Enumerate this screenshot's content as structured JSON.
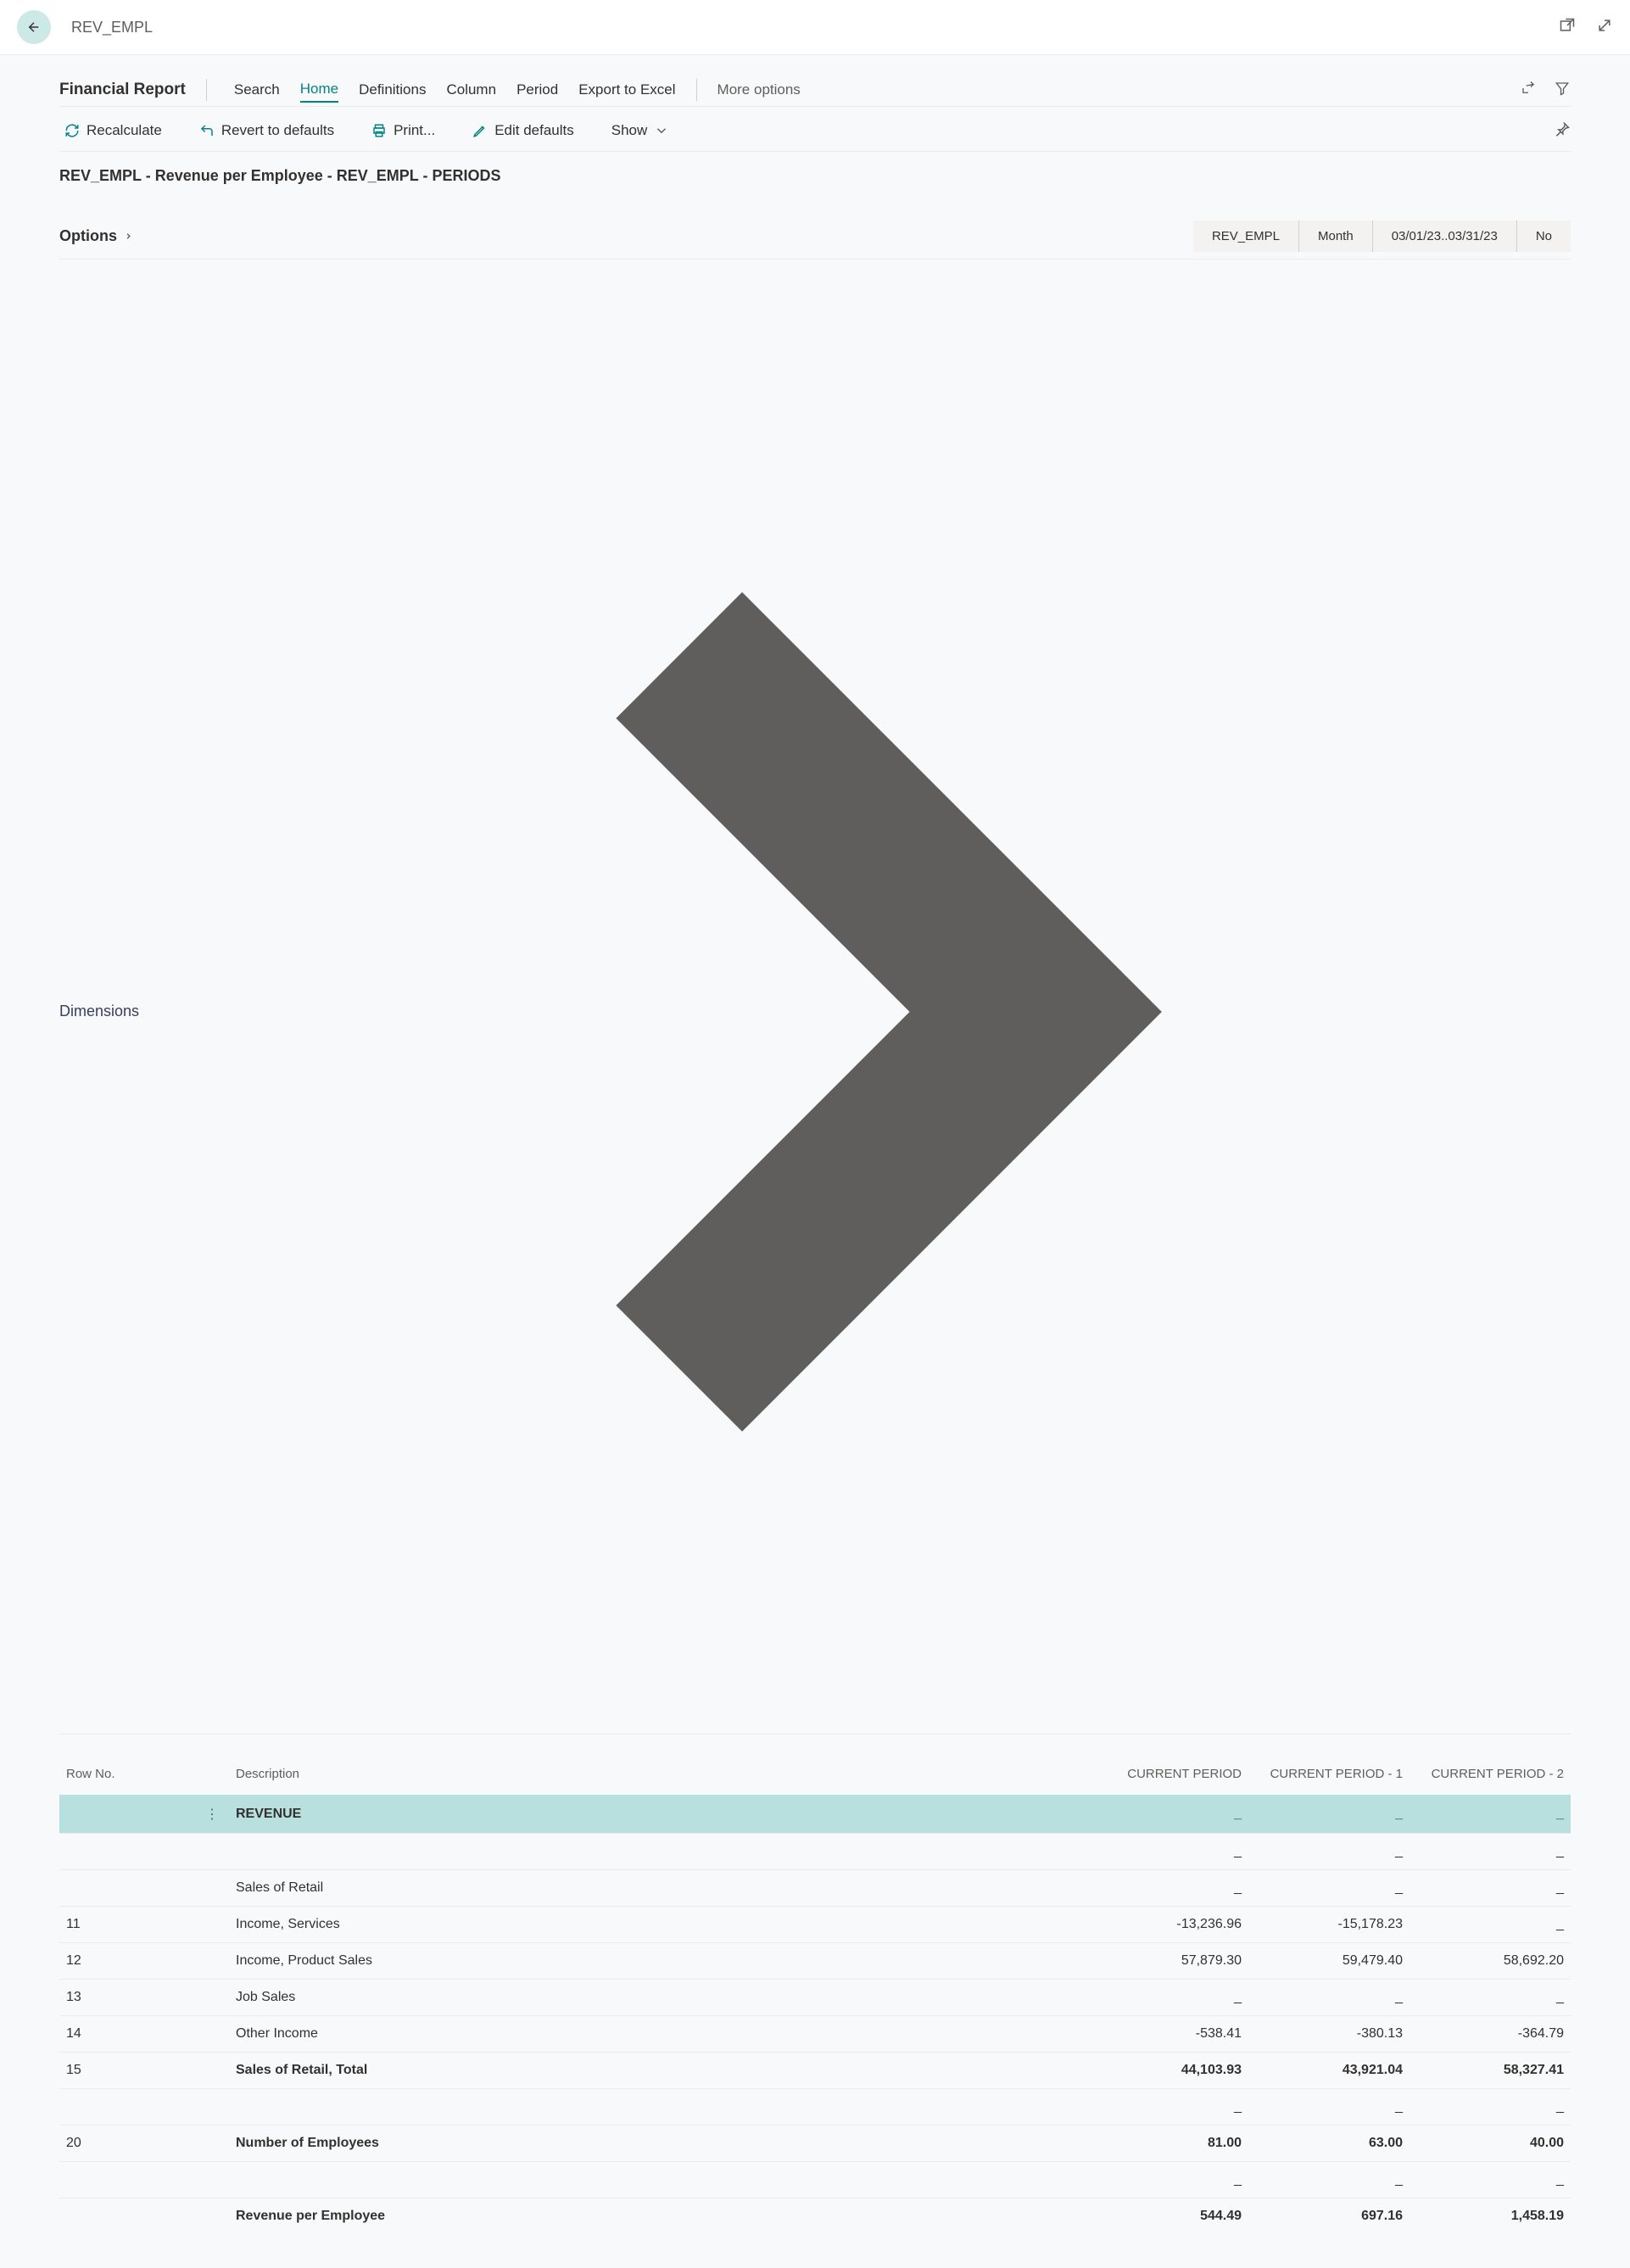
{
  "header": {
    "title": "REV_EMPL"
  },
  "toolbar1": {
    "financial_report": "Financial Report",
    "search": "Search",
    "home": "Home",
    "definitions": "Definitions",
    "column": "Column",
    "period": "Period",
    "export_excel": "Export to Excel",
    "more_options": "More options"
  },
  "toolbar2": {
    "recalculate": "Recalculate",
    "revert": "Revert to defaults",
    "print": "Print...",
    "edit_defaults": "Edit defaults",
    "show": "Show"
  },
  "report_title": "REV_EMPL - Revenue per Employee - REV_EMPL - PERIODS",
  "options": {
    "label": "Options",
    "chips": [
      "REV_EMPL",
      "Month",
      "03/01/23..03/31/23",
      "No"
    ]
  },
  "dimensions": {
    "label": "Dimensions"
  },
  "table": {
    "headers": {
      "rowno": "Row No.",
      "desc": "Description",
      "c1": "CURRENT PERIOD",
      "c2": "CURRENT PERIOD - 1",
      "c3": "CURRENT PERIOD - 2"
    },
    "rows": [
      {
        "rowno": "",
        "desc": "REVENUE",
        "c1": "_",
        "c2": "_",
        "c3": "_",
        "bold": true,
        "selected": true
      },
      {
        "rowno": "",
        "desc": "",
        "c1": "_",
        "c2": "_",
        "c3": "_"
      },
      {
        "rowno": "",
        "desc": "Sales of Retail",
        "c1": "_",
        "c2": "_",
        "c3": "_"
      },
      {
        "rowno": "11",
        "desc": "Income, Services",
        "c1": "-13,236.96",
        "c2": "-15,178.23",
        "c3": "_"
      },
      {
        "rowno": "12",
        "desc": "Income, Product Sales",
        "c1": "57,879.30",
        "c2": "59,479.40",
        "c3": "58,692.20"
      },
      {
        "rowno": "13",
        "desc": "Job Sales",
        "c1": "_",
        "c2": "_",
        "c3": "_"
      },
      {
        "rowno": "14",
        "desc": "Other Income",
        "c1": "-538.41",
        "c2": "-380.13",
        "c3": "-364.79"
      },
      {
        "rowno": "15",
        "desc": "Sales of Retail, Total",
        "c1": "44,103.93",
        "c2": "43,921.04",
        "c3": "58,327.41",
        "bold": true
      },
      {
        "rowno": "",
        "desc": "",
        "c1": "_",
        "c2": "_",
        "c3": "_"
      },
      {
        "rowno": "20",
        "desc": "Number of Employees",
        "c1": "81.00",
        "c2": "63.00",
        "c3": "40.00",
        "bold": true
      },
      {
        "rowno": "",
        "desc": "",
        "c1": "_",
        "c2": "_",
        "c3": "_"
      },
      {
        "rowno": "",
        "desc": "Revenue per Employee",
        "c1": "544.49",
        "c2": "697.16",
        "c3": "1,458.19",
        "bold": true
      }
    ]
  }
}
